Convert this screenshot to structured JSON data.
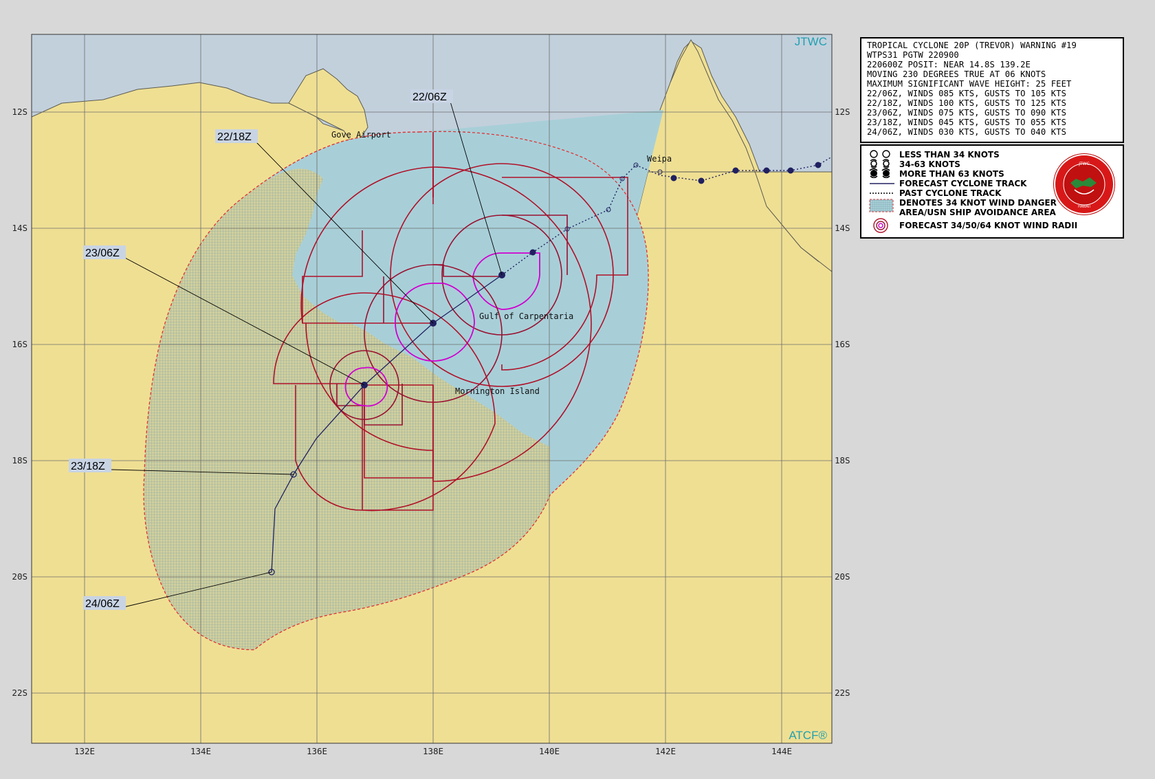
{
  "map": {
    "top_right_label": "JTWC",
    "bottom_right_label": "ATCF®",
    "lon_labels": [
      "132E",
      "134E",
      "136E",
      "138E",
      "140E",
      "142E",
      "144E"
    ],
    "lat_labels": [
      "12S",
      "14S",
      "16S",
      "18S",
      "20S",
      "22S"
    ],
    "place_labels": {
      "gove": "Gove Airport",
      "weipa": "Weipa",
      "gulf": "Gulf of Carpentaria",
      "mornington": "Mornington Island"
    },
    "colors": {
      "ocean": "#c2d0dc",
      "land": "#efdf93",
      "danger_area": "#a8cfd8",
      "radii_34": "#b01028",
      "radii_64": "#d000d0",
      "track": "#202060"
    },
    "forecast_points": [
      {
        "label": "22/06Z",
        "lat": -14.8,
        "lon": 139.2,
        "symbol": "more-than-63-knots"
      },
      {
        "label": "22/18Z",
        "lat": -15.7,
        "lon": 138.0,
        "symbol": "more-than-63-knots"
      },
      {
        "label": "23/06Z",
        "lat": -16.7,
        "lon": 136.8,
        "symbol": "more-than-63-knots"
      },
      {
        "label": "23/18Z",
        "lat": -18.2,
        "lon": 135.6,
        "symbol": "34-63-knots"
      },
      {
        "label": "24/06Z",
        "lat": -19.9,
        "lon": 135.2,
        "symbol": "less-than-34-knots"
      }
    ]
  },
  "warning": {
    "lines": [
      "TROPICAL CYCLONE 20P (TREVOR) WARNING #19",
      "WTPS31 PGTW 220900",
      "220600Z POSIT: NEAR 14.8S 139.2E",
      "MOVING 230 DEGREES TRUE AT 06 KNOTS",
      "MAXIMUM SIGNIFICANT WAVE HEIGHT: 25 FEET",
      "22/06Z, WINDS 085 KTS, GUSTS TO 105 KTS",
      "22/18Z, WINDS 100 KTS, GUSTS TO 125 KTS",
      "23/06Z, WINDS 075 KTS, GUSTS TO 090 KTS",
      "23/18Z, WINDS 045 KTS, GUSTS TO 055 KTS",
      "24/06Z, WINDS 030 KTS, GUSTS TO 040 KTS"
    ]
  },
  "legend": {
    "items": [
      {
        "label": "LESS THAN 34 KNOTS",
        "icon": "open-circle-icon"
      },
      {
        "label": "34-63 KNOTS",
        "icon": "storm-symbol-icon"
      },
      {
        "label": "MORE THAN 63 KNOTS",
        "icon": "filled-storm-icon"
      },
      {
        "label": "FORECAST CYCLONE TRACK",
        "icon": "solid-line-icon"
      },
      {
        "label": "PAST CYCLONE TRACK",
        "icon": "dotted-line-icon"
      },
      {
        "label": "DENOTES 34 KNOT WIND DANGER",
        "icon": "danger-area-icon"
      },
      {
        "label": "AREA/USN SHIP AVOIDANCE AREA",
        "icon": ""
      },
      {
        "label": "FORECAST 34/50/64 KNOT WIND RADII",
        "icon": "wind-radii-icon"
      }
    ],
    "seal_text": [
      "JOINT TYPHOON WARNING CENTER",
      "PEARL HARBOR HAWAII"
    ]
  }
}
